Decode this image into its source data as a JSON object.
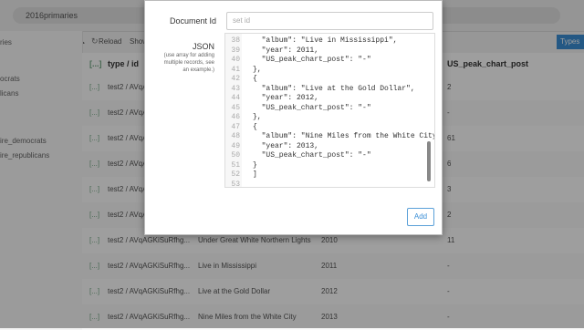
{
  "topbar": {
    "url": "2016primaries"
  },
  "toolbar": {
    "reload": "Reload",
    "show": "Show",
    "types": "Types"
  },
  "sidebar": {
    "items": [
      "ries",
      "ocrats",
      "licans",
      "ire_democrats",
      "ire_republicans"
    ]
  },
  "grid": {
    "headers": [
      "type / id",
      "US_peak_chart_post"
    ],
    "rows": [
      {
        "id": "test2 / AVqA",
        "title": "",
        "year": "",
        "peak": "2"
      },
      {
        "id": "test2 / AVqA",
        "title": "",
        "year": "",
        "peak": "-"
      },
      {
        "id": "test2 / AVqA",
        "title": "",
        "year": "",
        "peak": "61"
      },
      {
        "id": "test2 / AVqA",
        "title": "",
        "year": "",
        "peak": "6"
      },
      {
        "id": "test2 / AVqA",
        "title": "",
        "year": "",
        "peak": "3"
      },
      {
        "id": "test2 / AVqA",
        "title": "",
        "year": "",
        "peak": "2"
      },
      {
        "id": "test2 / AVqAGKiSuRfhg...",
        "title": "Under Great White Northern Lights",
        "year": "2010",
        "peak": "11"
      },
      {
        "id": "test2 / AVqAGKiSuRfhg...",
        "title": "Live in Mississippi",
        "year": "2011",
        "peak": "-"
      },
      {
        "id": "test2 / AVqAGKiSuRfhg...",
        "title": "Live at the Gold Dollar",
        "year": "2012",
        "peak": "-"
      },
      {
        "id": "test2 / AVqAGKiSuRfhg...",
        "title": "Nine Miles from the White City",
        "year": "2013",
        "peak": "-"
      }
    ]
  },
  "modal": {
    "doc_id_label": "Document Id",
    "doc_id_placeholder": "set id",
    "json_label": "JSON",
    "json_hint": "(use array for adding multiple records, see an example.)",
    "add_label": "Add",
    "line_numbers": [
      "38",
      "39",
      "40",
      "41",
      "42",
      "43",
      "44",
      "45",
      "46",
      "47",
      "48",
      "49",
      "50",
      "51",
      "52",
      "53"
    ],
    "code_lines": [
      "  \"album\": \"Live in Mississippi\",",
      "  \"year\": 2011,",
      "  \"US_peak_chart_post\": \"-\"",
      "},",
      "{",
      "  \"album\": \"Live at the Gold Dollar\",",
      "  \"year\": 2012,",
      "  \"US_peak_chart_post\": \"-\"",
      "},",
      "{",
      "  \"album\": \"Nine Miles from the White City",
      "  \"year\": 2013,",
      "  \"US_peak_chart_post\": \"-\"",
      "}",
      "]",
      ""
    ]
  },
  "colors": {
    "accent": "#3b8fd6",
    "types_btn": "#3b8fd6"
  }
}
